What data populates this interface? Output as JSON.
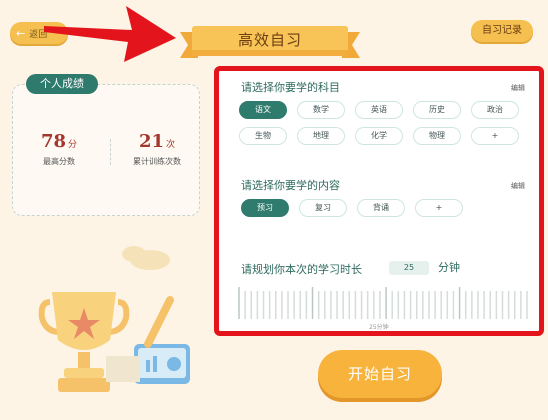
{
  "header": {
    "back_label": "返回",
    "title": "高效自习",
    "record_label": "自习记录"
  },
  "stats": {
    "tag": "个人成绩",
    "items": [
      {
        "value": "78",
        "unit": "分",
        "label": "最高分数"
      },
      {
        "value": "21",
        "unit": "次",
        "label": "累计训练次数"
      }
    ]
  },
  "panel": {
    "subject_section": {
      "title": "请选择你要学的科目",
      "edit": "编辑",
      "chips": [
        "语文",
        "数学",
        "英语",
        "历史",
        "政治",
        "生物",
        "地理",
        "化学",
        "物理",
        "+"
      ],
      "selected_index": 0
    },
    "content_section": {
      "title": "请选择你要学的内容",
      "edit": "编辑",
      "chips": [
        "预习",
        "复习",
        "背诵",
        "+"
      ],
      "selected_index": 0
    },
    "duration_section": {
      "title": "请规划你本次的学习时长",
      "value": "25",
      "unit": "分钟",
      "slider_label": "25分钟"
    }
  },
  "start_button": "开始自习",
  "colors": {
    "accent": "#2f7b6d",
    "button": "#f7b33b",
    "highlight_border": "#e3141b",
    "value_red": "#a4362d"
  }
}
